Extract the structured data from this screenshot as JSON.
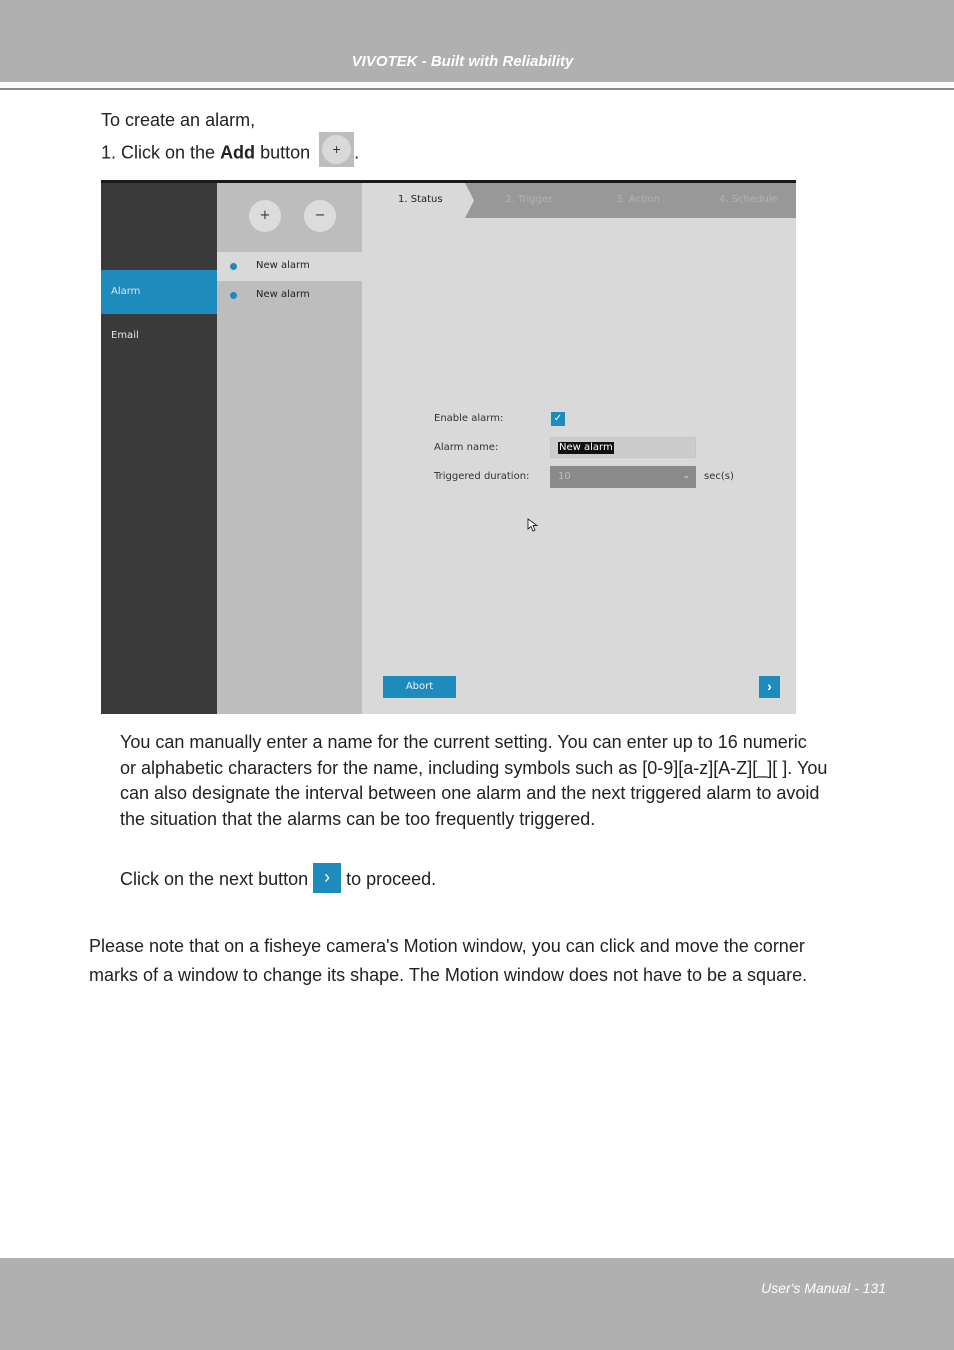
{
  "header": {
    "title": "VIVOTEK - Built with Reliability"
  },
  "intro": {
    "line1": "To create an alarm,",
    "step1_prefix": "1. Click on the ",
    "step1_bold": "Add",
    "step1_suffix": " button",
    "step1_end": ".",
    "add_icon": "+"
  },
  "screenshot": {
    "sidebar": [
      {
        "label": "Alarm",
        "active": true
      },
      {
        "label": "Email",
        "active": false
      }
    ],
    "add_button": "+",
    "remove_button": "−",
    "alarm_list": [
      {
        "label": "New alarm",
        "selected": true
      },
      {
        "label": "New alarm",
        "selected": false
      }
    ],
    "steps": [
      {
        "label": "1. Status",
        "active": true
      },
      {
        "label": "2. Trigger",
        "active": false
      },
      {
        "label": "3. Action",
        "active": false
      },
      {
        "label": "4. Schedule",
        "active": false
      }
    ],
    "form": {
      "enable_label": "Enable alarm:",
      "enable_checked": true,
      "check_icon": "✓",
      "name_label": "Alarm name:",
      "name_value": "New alarm",
      "duration_label": "Triggered duration:",
      "duration_value": "10",
      "duration_unit": "sec(s)",
      "dropdown_icon": "⌄"
    },
    "abort_label": "Abort",
    "next_icon": "›",
    "accent_color": "#1e8bbd"
  },
  "body": {
    "para1": [
      "You can manually enter a name for the current setting. You can enter up to 16 numeric",
      "or alphabetic characters for the name, including symbols such as [0-9][a-z][A-Z][_][ ]. You",
      "can also designate the interval between one alarm and the next triggered alarm to avoid",
      "the situation that the alarms can be too frequently triggered."
    ],
    "next_prefix": "Click on the next button ",
    "next_suffix": " to proceed.",
    "next_icon": "›",
    "para2": [
      "Please note that on a fisheye camera's Motion window, you can click and move the corner",
      "marks of a window to change its shape. The Motion window does not have to be a square."
    ]
  },
  "footer": {
    "text": "User's Manual - 131"
  }
}
